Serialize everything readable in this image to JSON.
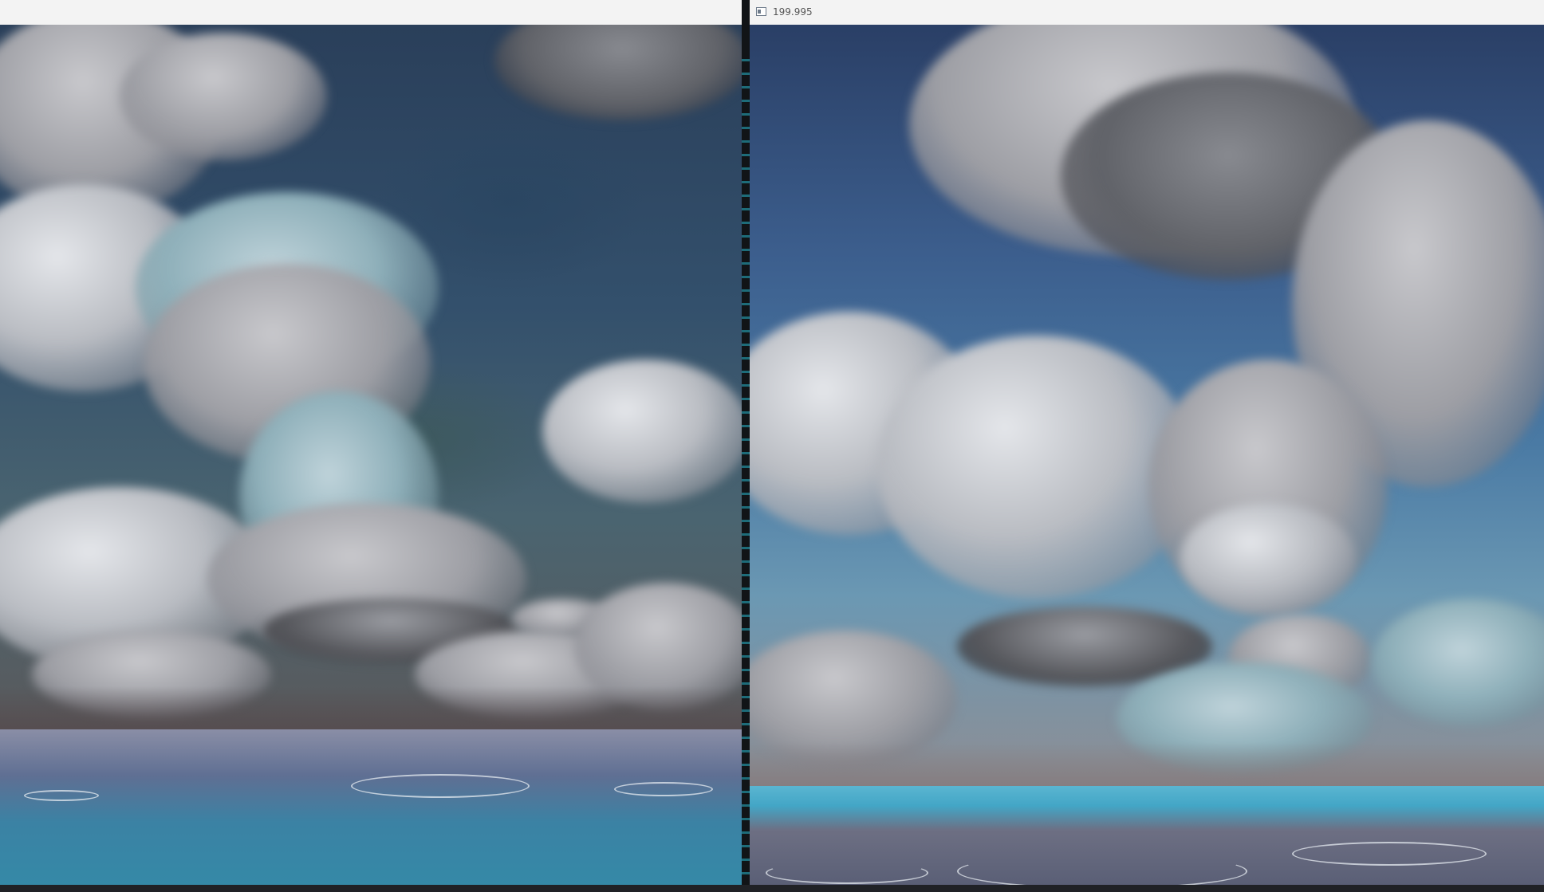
{
  "left_window": {
    "name": "render-view-left"
  },
  "right_window": {
    "title": "199.995"
  },
  "colors": {
    "left_sky": "#2a3f5a",
    "left_sea": "#3589a7",
    "right_sky": "#3c5e8d",
    "right_sea": "#43a6c6",
    "divider": "#111417",
    "console_accent": "#27b3c9"
  }
}
